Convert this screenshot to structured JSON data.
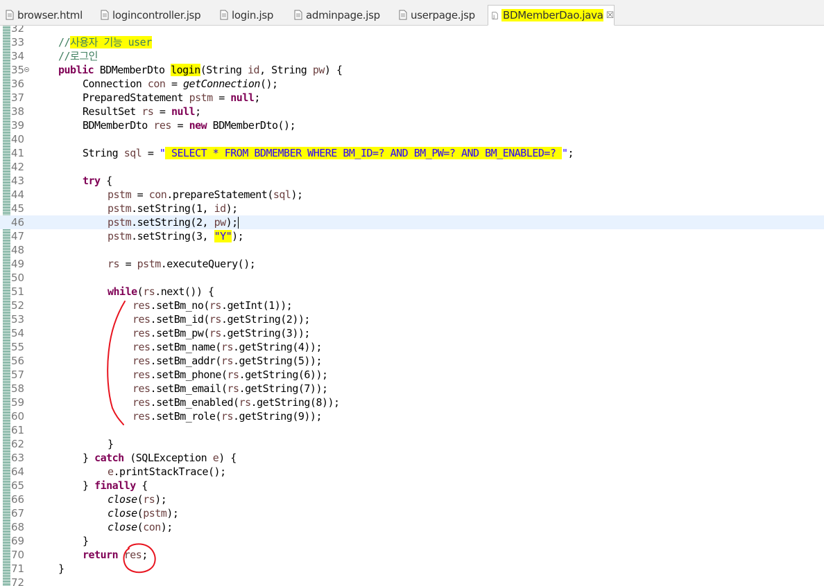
{
  "tabs": [
    {
      "label": "browser.html",
      "icon": "html-file-icon"
    },
    {
      "label": "logincontroller.jsp",
      "icon": "jsp-file-icon"
    },
    {
      "label": "login.jsp",
      "icon": "jsp-file-icon"
    },
    {
      "label": "adminpage.jsp",
      "icon": "jsp-file-icon"
    },
    {
      "label": "userpage.jsp",
      "icon": "jsp-file-icon"
    },
    {
      "label": "BDMemberDao.java",
      "icon": "java-file-icon",
      "active": true,
      "close": "☒"
    }
  ],
  "editor": {
    "line_numbers": [
      "32",
      "33",
      "34",
      "35",
      "36",
      "37",
      "38",
      "39",
      "40",
      "41",
      "42",
      "43",
      "44",
      "45",
      "46",
      "47",
      "48",
      "49",
      "50",
      "51",
      "52",
      "53",
      "54",
      "55",
      "56",
      "57",
      "58",
      "59",
      "60",
      "61",
      "62",
      "63",
      "64",
      "65",
      "66",
      "67",
      "68",
      "69",
      "70",
      "71",
      "72"
    ],
    "current_line": "46",
    "code": {
      "l33_comment": "//",
      "l33_comment_hl": "사용자 기능 user",
      "l34_comment": "//로그인",
      "kw_public": "public",
      "l35_type": " BDMemberDto ",
      "l35_method": "login",
      "l35_params_a": "(String ",
      "p_id": "id",
      "l35_params_b": ", String ",
      "p_pw": "pw",
      "l35_params_c": ") {",
      "l36_a": "Connection ",
      "v_con": "con",
      "l36_b": " = ",
      "l36_call": "getConnection",
      "l36_c": "();",
      "l37_a": "PreparedStatement ",
      "v_pstm": "pstm",
      "l37_b": " = ",
      "kw_null": "null",
      "semicolon": ";",
      "l38_a": "ResultSet ",
      "v_rs": "rs",
      "l39_a": "BDMemberDto ",
      "v_res": "res",
      "kw_new": "new",
      "l39_b": " BDMemberDto();",
      "l41_a": "String ",
      "v_sql": "sql",
      "l41_b": " = ",
      "l41_q1": "\"",
      "l41_sql_hl": " SELECT * FROM BDMEMBER WHERE BM_ID=? AND BM_PW=? AND BM_ENABLED=? ",
      "l41_q2": "\"",
      "kw_try": "try",
      "open_brace": " {",
      "l44_b": " = ",
      "l44_c": ".prepareStatement(",
      "l44_d": ");",
      "set_string": ".setString(",
      "l45_a": "1, ",
      "l46_a": "2, ",
      "l47_a": "3, ",
      "l47_str": "\"Y\"",
      "close_call": ");",
      "l49_b": " = ",
      "l49_c": ".executeQuery();",
      "kw_while": "while",
      "l51_a": "(",
      "l51_b": ".next()) {",
      "setters": [
        {
          "method": ".setBm_no(",
          "getter": ".getInt(1));"
        },
        {
          "method": ".setBm_id(",
          "getter": ".getString(2));"
        },
        {
          "method": ".setBm_pw(",
          "getter": ".getString(3));"
        },
        {
          "method": ".setBm_name(",
          "getter": ".getString(4));"
        },
        {
          "method": ".setBm_addr(",
          "getter": ".getString(5));"
        },
        {
          "method": ".setBm_phone(",
          "getter": ".getString(6));"
        },
        {
          "method": ".setBm_email(",
          "getter": ".getString(7));"
        },
        {
          "method": ".setBm_enabled(",
          "getter": ".getString(8));"
        },
        {
          "method": ".setBm_role(",
          "getter": ".getString(9));"
        }
      ],
      "close_brace": "}",
      "l63_a": "} ",
      "kw_catch": "catch",
      "l63_b": " (SQLException ",
      "v_e": "e",
      "l63_c": ") {",
      "l64_b": ".printStackTrace();",
      "kw_finally": "finally",
      "call_close": "close",
      "paren_open": "(",
      "kw_return": "return"
    }
  },
  "colors": {
    "highlight": "#ffff00",
    "keyword": "#7f0055",
    "variable": "#6a3e3e",
    "comment": "#3f7f5f",
    "string": "#2a00ff",
    "annotation": "#e8141f",
    "current_line": "#e8f2fe"
  }
}
